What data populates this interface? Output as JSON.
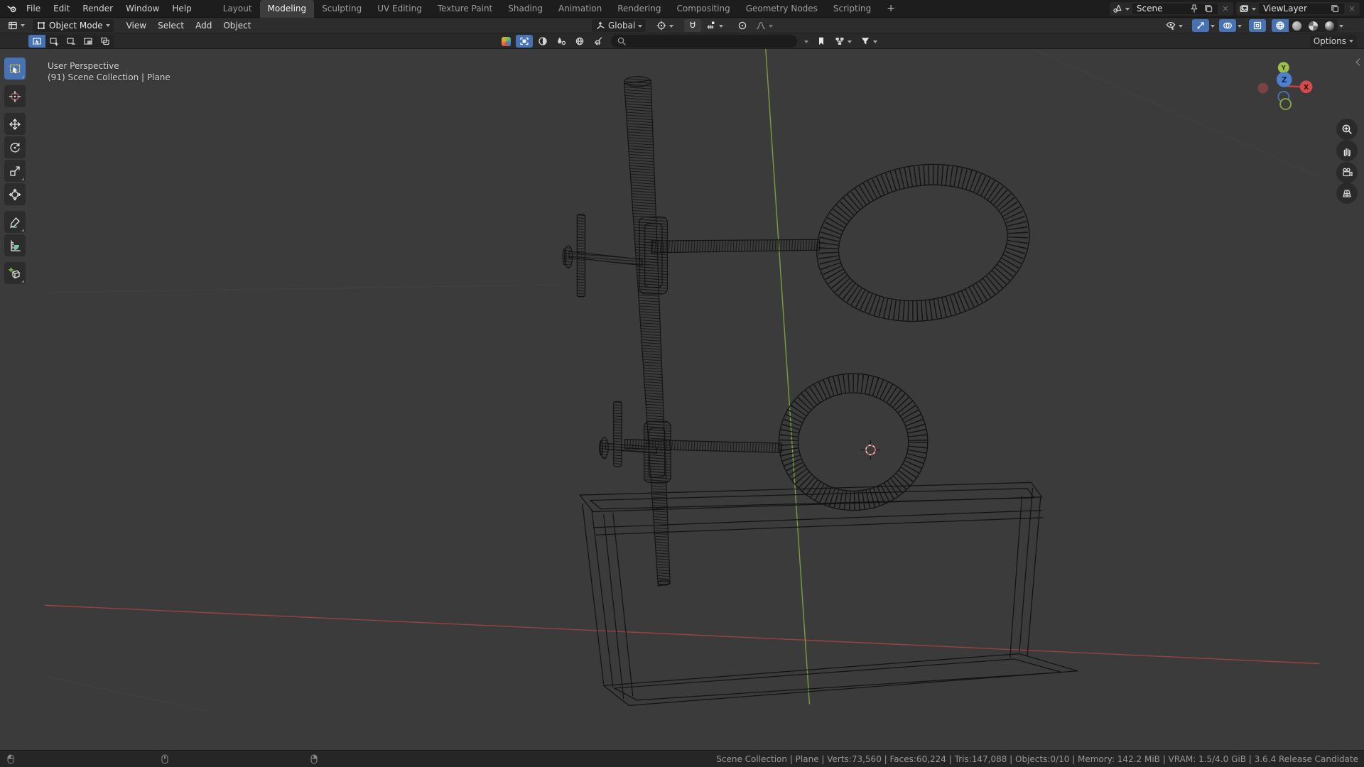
{
  "colors": {
    "accent": "#4772b3",
    "axis_x": "#a34444",
    "axis_y": "#7da33c",
    "viewport_bg": "#3b3b3b",
    "wire": "#121212"
  },
  "topbar": {
    "menus": [
      {
        "label": "File"
      },
      {
        "label": "Edit"
      },
      {
        "label": "Render"
      },
      {
        "label": "Window"
      },
      {
        "label": "Help"
      }
    ],
    "tabs": [
      {
        "label": "Layout"
      },
      {
        "label": "Modeling"
      },
      {
        "label": "Sculpting"
      },
      {
        "label": "UV Editing"
      },
      {
        "label": "Texture Paint"
      },
      {
        "label": "Shading"
      },
      {
        "label": "Animation"
      },
      {
        "label": "Rendering"
      },
      {
        "label": "Compositing"
      },
      {
        "label": "Geometry Nodes"
      },
      {
        "label": "Scripting"
      }
    ],
    "active_tab": "Modeling",
    "add_tab_label": "+",
    "scene_selector": {
      "value": "Scene"
    },
    "view_layer_selector": {
      "value": "ViewLayer"
    }
  },
  "viewport_header": {
    "mode": "Object Mode",
    "menus": [
      "View",
      "Select",
      "Add",
      "Object"
    ],
    "orientation": "Global"
  },
  "tool_header": {
    "options_label": "Options"
  },
  "viewport": {
    "view_label": "User Perspective",
    "context_label": "(91) Scene Collection | Plane",
    "axis_labels": {
      "x": "X",
      "y": "Y",
      "z": "Z"
    }
  },
  "statusbar": {
    "info": "Scene Collection | Plane | Verts:73,560 | Faces:60,224 | Tris:147,088 | Objects:0/10 | Memory: 142.2 MiB | VRAM: 1.5/4.0 GiB | 3.6.4 Release Candidate"
  },
  "icons": {
    "toolbar": [
      "select-box",
      "cursor",
      "move",
      "rotate",
      "scale",
      "transform",
      "annotate",
      "measure",
      "add-cube"
    ],
    "shading_modes": [
      "wireframe",
      "solid",
      "material-preview",
      "rendered"
    ],
    "nav": [
      "zoom",
      "pan",
      "camera-view",
      "toggle-perspective"
    ]
  }
}
